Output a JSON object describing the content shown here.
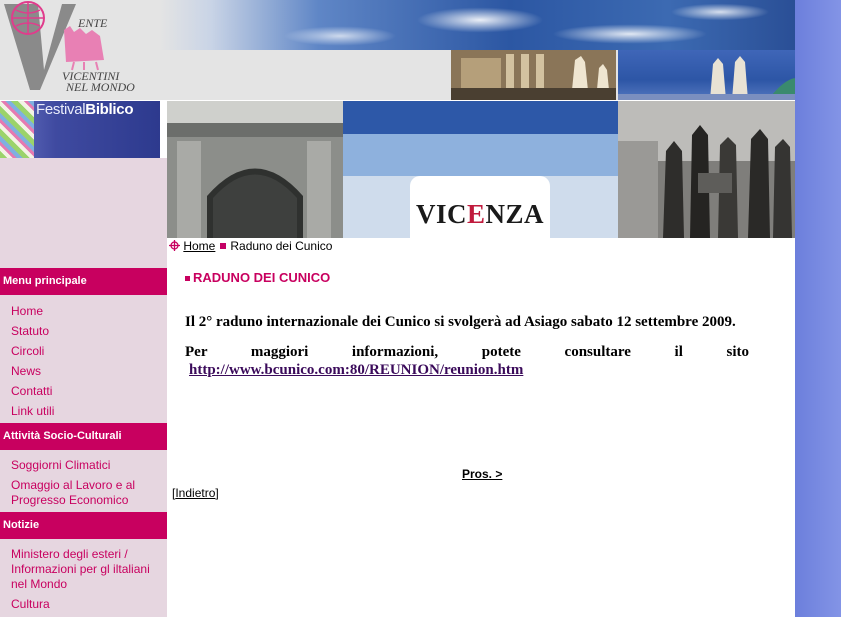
{
  "header": {
    "logo": {
      "line1": "ENTE",
      "line2": "VICENTINI",
      "line3": "NEL MONDO"
    },
    "festival": {
      "word1": "Festival",
      "word2": "Biblico"
    },
    "banner_word": {
      "before": "VIC",
      "accent": "E",
      "after": "NZA"
    }
  },
  "breadcrumb": {
    "home": "Home",
    "current": "Raduno dei Cunico"
  },
  "sidebar": {
    "sections": [
      {
        "title": "Menu principale",
        "items": [
          "Home",
          "Statuto",
          "Circoli",
          "News",
          "Contatti",
          "Link utili"
        ]
      },
      {
        "title": "Attività Socio-Culturali",
        "items": [
          "Soggiorni Climatici",
          "Omaggio al Lavoro e al Progresso Economico"
        ]
      },
      {
        "title": "Notizie",
        "items": [
          "Ministero degli esteri / Informazioni per gl iltaliani nel Mondo",
          "Cultura"
        ]
      }
    ]
  },
  "content": {
    "title": "RADUNO DEI CUNICO",
    "paragraph1": "Il 2° raduno internazionale dei Cunico si svolgerà ad Asiago sabato 12 settembre 2009.",
    "paragraph2": "Per maggiori informazioni, potete consultare il sito",
    "link": "http://www.bcunico.com:80/REUNION/reunion.htm",
    "next": "Pros. >",
    "back": "Indietro"
  },
  "colors": {
    "accent": "#c8005f",
    "sidebar_bg": "#e6d6e0",
    "right_bar": "#7b8ddf"
  }
}
